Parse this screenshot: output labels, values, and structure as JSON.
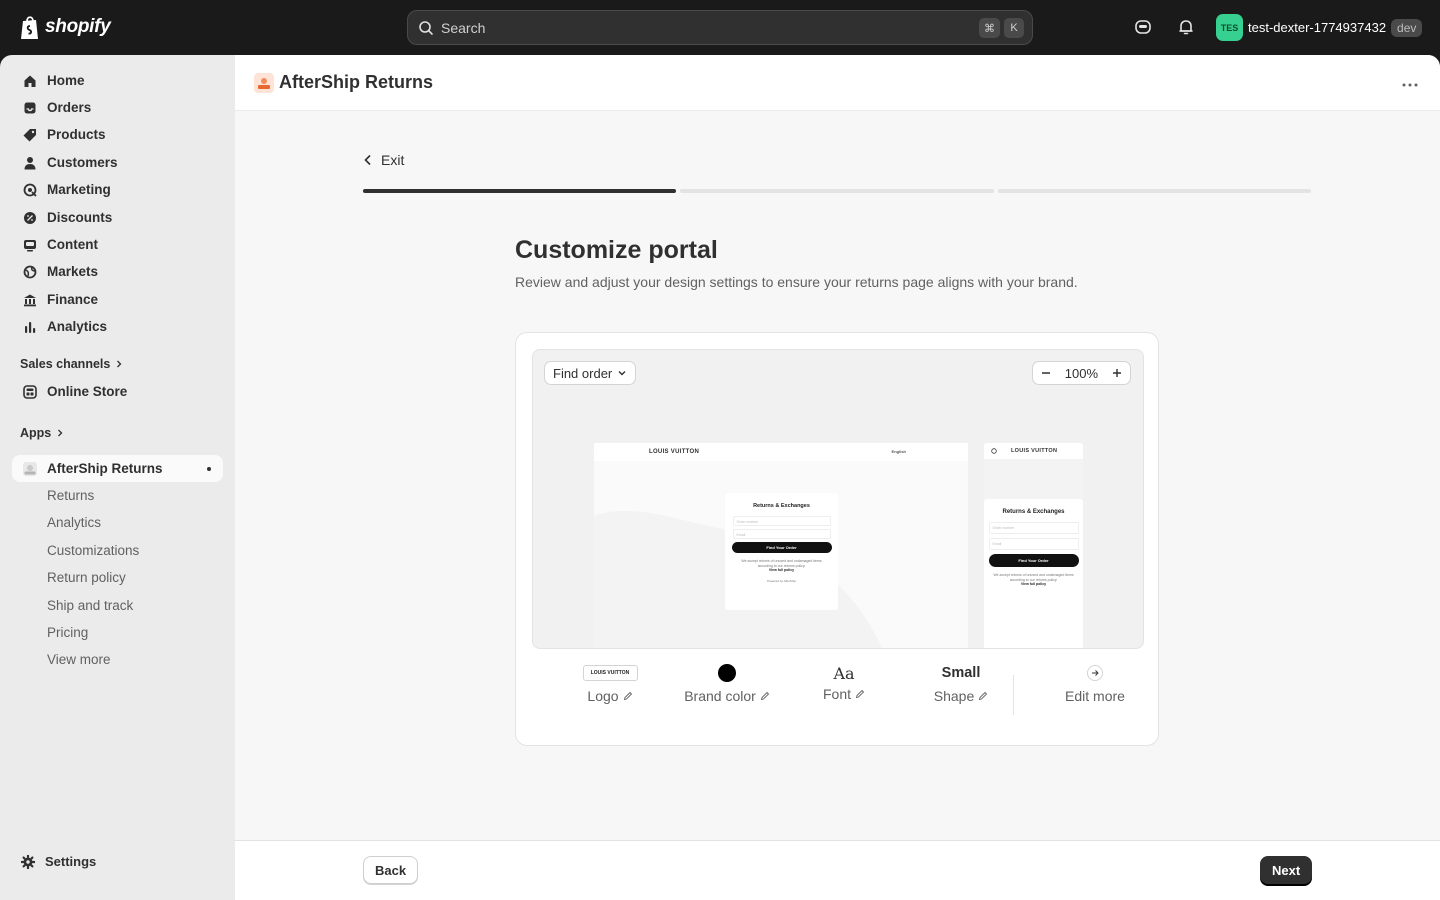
{
  "topbar": {
    "brand": "shopify",
    "search_placeholder": "Search",
    "shortcut_keys": [
      "⌘",
      "K"
    ],
    "store_initials": "TES",
    "store_name": "test-dexter-1774937432",
    "store_badge": "dev"
  },
  "sidebar": {
    "items": [
      {
        "label": "Home",
        "icon": "home-icon"
      },
      {
        "label": "Orders",
        "icon": "inbox-icon"
      },
      {
        "label": "Products",
        "icon": "tag-icon"
      },
      {
        "label": "Customers",
        "icon": "person-icon"
      },
      {
        "label": "Marketing",
        "icon": "target-icon"
      },
      {
        "label": "Discounts",
        "icon": "discount-icon"
      },
      {
        "label": "Content",
        "icon": "image-icon"
      },
      {
        "label": "Markets",
        "icon": "globe-icon"
      },
      {
        "label": "Finance",
        "icon": "bank-icon"
      },
      {
        "label": "Analytics",
        "icon": "bar-chart-icon"
      }
    ],
    "sales_channels_label": "Sales channels",
    "online_store_label": "Online Store",
    "apps_label": "Apps",
    "app_label": "AfterShip Returns",
    "app_sub_items": [
      "Returns",
      "Analytics",
      "Customizations",
      "Return policy",
      "Ship and track",
      "Pricing",
      "View more"
    ],
    "settings_label": "Settings"
  },
  "header": {
    "app_title": "AfterShip Returns"
  },
  "wizard": {
    "exit_label": "Exit",
    "step_total": 3,
    "step_current": 1,
    "title": "Customize portal",
    "description": "Review and adjust your design settings to ensure your returns page aligns with your brand."
  },
  "preview": {
    "page_select": "Find order",
    "zoom_level": "100%",
    "mock_brand": "LOUIS VUITTON",
    "mock_lang": "English",
    "mock_title": "Returns & Exchanges",
    "mock_order_placeholder": "Order number",
    "mock_email_placeholder": "Email",
    "mock_button": "Find Your Order",
    "mock_policy_text": "We accept returns of unused and undamaged items according to our returns policy.",
    "mock_policy_link": "View full policy",
    "mock_powered": "Powered by AfterShip"
  },
  "settings_tools": {
    "logo_preview": "LOUIS VUITTON",
    "logo_label": "Logo",
    "brand_color": "#000000",
    "brand_color_label": "Brand color",
    "font_preview": "Aa",
    "font_label": "Font",
    "shape_value": "Small",
    "shape_label": "Shape",
    "edit_more_label": "Edit more"
  },
  "footer": {
    "back_label": "Back",
    "next_label": "Next"
  }
}
